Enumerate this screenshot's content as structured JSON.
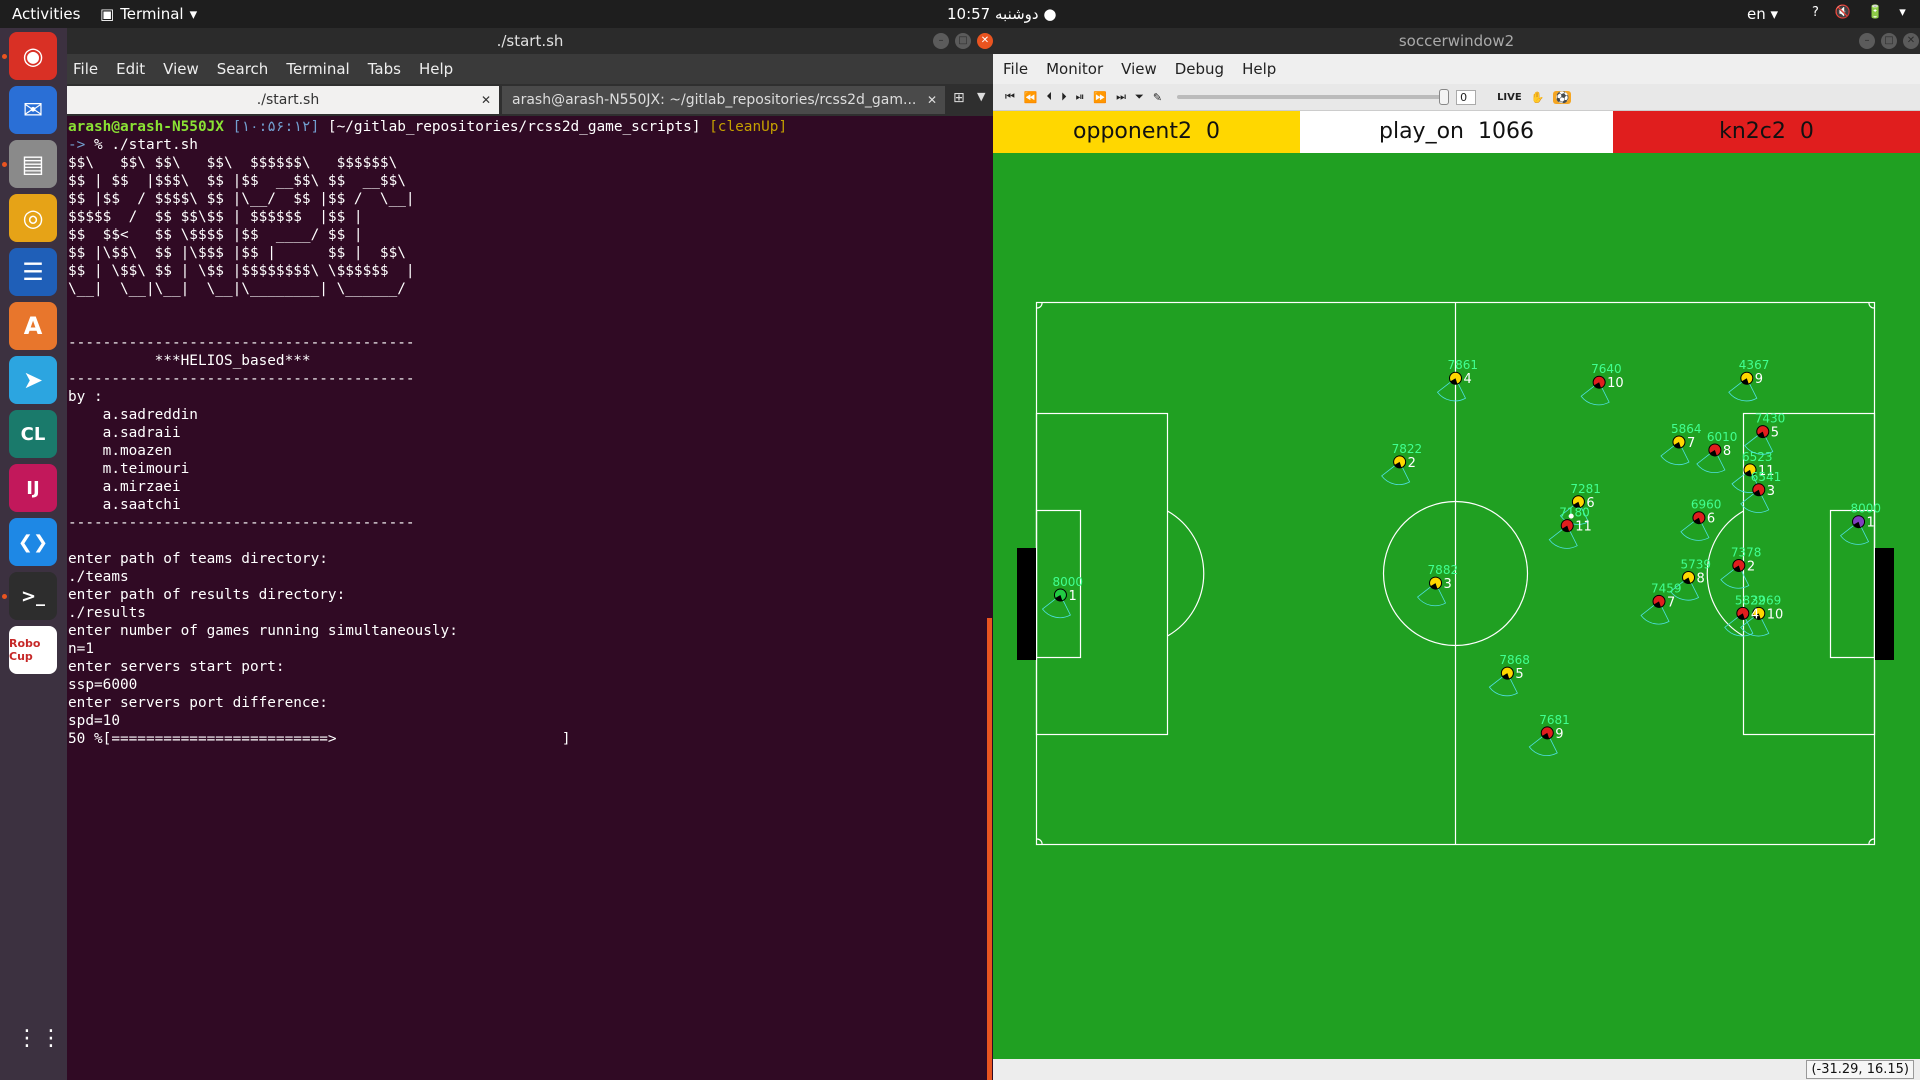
{
  "topbar": {
    "activities": "Activities",
    "app_name": "Terminal",
    "app_caret": "▾",
    "clock": "10:57 دوشنبه ●",
    "lang": "en ▾",
    "icons": [
      "?",
      "🔇",
      "🔋",
      "▾"
    ]
  },
  "dock": {
    "items": [
      {
        "name": "chrome-icon",
        "glyph": "◉",
        "bg": "#d93025"
      },
      {
        "name": "thunderbird-icon",
        "glyph": "✉",
        "bg": "#2a6fd6"
      },
      {
        "name": "files-icon",
        "glyph": "▤",
        "bg": "#8a8a8a"
      },
      {
        "name": "rhythmbox-icon",
        "glyph": "◎",
        "bg": "#e6a317"
      },
      {
        "name": "writer-icon",
        "glyph": "☰",
        "bg": "#1f5fb8"
      },
      {
        "name": "software-icon",
        "glyph": "A",
        "bg": "#e8762c"
      },
      {
        "name": "telegram-icon",
        "glyph": "➤",
        "bg": "#2ca5e0"
      },
      {
        "name": "clion-icon",
        "glyph": "CL",
        "bg": "#1a7a6b"
      },
      {
        "name": "intellij-icon",
        "glyph": "IJ",
        "bg": "#c2185b"
      },
      {
        "name": "vscode-icon",
        "glyph": "❮❯",
        "bg": "#1e88e5"
      },
      {
        "name": "terminal-icon",
        "glyph": ">_",
        "bg": "#2d2d2d"
      },
      {
        "name": "robocup-icon",
        "glyph": "Robo Cup",
        "bg": "#ffffff"
      }
    ],
    "apps_grid_glyph": "⋮⋮⋮"
  },
  "terminal": {
    "title": "./start.sh",
    "menu": [
      "File",
      "Edit",
      "View",
      "Search",
      "Terminal",
      "Tabs",
      "Help"
    ],
    "tabs": [
      {
        "label": "./start.sh",
        "active": true
      },
      {
        "label": "arash@arash-N550JX: ~/gitlab_repositories/rcss2d_gam...",
        "active": false
      }
    ],
    "prompt_user": "arash@arash-N550JX",
    "prompt_time": " [۱۰:۵۶:۱۲]",
    "prompt_path": " [~/gitlab_repositories/rcss2d_game_scripts]",
    "prompt_branch": " [cleanUp]",
    "prompt_cmd_prefix": "-> ",
    "prompt_cmd": "% ./start.sh",
    "output": "\n$$\\   $$\\ $$\\   $$\\  $$$$$$\\   $$$$$$\\\n$$ | $$  |$$$\\  $$ |$$  __$$\\ $$  __$$\\\n$$ |$$  / $$$$\\ $$ |\\__/  $$ |$$ /  \\__|\n$$$$$  /  $$ $$\\$$ | $$$$$$  |$$ |\n$$  $$<   $$ \\$$$$ |$$  ____/ $$ |\n$$ |\\$$\\  $$ |\\$$$ |$$ |      $$ |  $$\\\n$$ | \\$$\\ $$ | \\$$ |$$$$$$$$\\ \\$$$$$$  |\n\\__|  \\__|\\__|  \\__|\\________| \\______/\n\n\n----------------------------------------\n          ***HELIOS_based***\n----------------------------------------\nby :\n    a.sadreddin\n    a.sadraii\n    m.moazen\n    m.teimouri\n    a.mirzaei\n    a.saatchi\n----------------------------------------\n\nenter path of teams directory:\n./teams\nenter path of results directory:\n./results\nenter number of games running simultaneously:\nn=1\nenter servers start port:\nssp=6000\nenter servers port difference:\nspd=10\n50 %[=========================>                          ]"
  },
  "soccerwindow": {
    "title": "soccerwindow2",
    "menu": [
      "File",
      "Monitor",
      "View",
      "Debug",
      "Help"
    ],
    "toolbar": {
      "glyphs": [
        "⏮",
        "⏪",
        "⏴",
        "⏵",
        "⏯",
        "⏩",
        "⏭",
        "⏷",
        "✎"
      ],
      "slider_value": "0",
      "live_label": "LIVE",
      "hand_glyph": "✋",
      "logo_glyph": "⚽"
    },
    "score": {
      "left_team": "opponent2",
      "left_score": "0",
      "mode": "play_on",
      "cycle": "1066",
      "right_team": "kn2c2",
      "right_score": "0"
    },
    "coord": "(-31.29, 16.15)",
    "colors": {
      "field": "#20a022",
      "yellow_team": "#ffd700",
      "red_team": "#e01e1e",
      "mode_bg": "#ffffff"
    },
    "players": [
      {
        "team": "yellow",
        "unum": "4",
        "stamina": "7861",
        "x": 0.0,
        "y": -24.5
      },
      {
        "team": "yellow",
        "unum": "2",
        "stamina": "7822",
        "x": -7.0,
        "y": -14.0
      },
      {
        "team": "yellow",
        "unum": "3",
        "stamina": "7882",
        "x": -2.5,
        "y": 1.2
      },
      {
        "team": "yellow",
        "unum": "5",
        "stamina": "7868",
        "x": 6.5,
        "y": 12.5
      },
      {
        "team": "yellow",
        "unum": "6",
        "stamina": "7281",
        "x": 15.4,
        "y": -9.0
      },
      {
        "team": "yellow",
        "unum": "7",
        "stamina": "5864",
        "x": 28.0,
        "y": -16.5
      },
      {
        "team": "yellow",
        "unum": "8",
        "stamina": "5739",
        "x": 29.2,
        "y": 0.5
      },
      {
        "team": "yellow",
        "unum": "9",
        "stamina": "4367",
        "x": 36.5,
        "y": -24.5
      },
      {
        "team": "yellow",
        "unum": "10",
        "stamina": "3969",
        "x": 38.0,
        "y": 5.0
      },
      {
        "team": "yellow",
        "unum": "11",
        "stamina": "6523",
        "x": 36.9,
        "y": -13.0
      },
      {
        "team": "yellow",
        "unum": "1",
        "stamina": "8000",
        "x": -49.5,
        "y": 2.7,
        "goalie": true
      },
      {
        "team": "red",
        "unum": "10",
        "stamina": "7640",
        "x": 18.0,
        "y": -24.0
      },
      {
        "team": "red",
        "unum": "11",
        "stamina": "7180",
        "x": 14.0,
        "y": -6.0
      },
      {
        "team": "red",
        "unum": "9",
        "stamina": "7681",
        "x": 11.5,
        "y": 20.0
      },
      {
        "team": "red",
        "unum": "8",
        "stamina": "6010",
        "x": 32.5,
        "y": -15.5
      },
      {
        "team": "red",
        "unum": "6",
        "stamina": "6960",
        "x": 30.5,
        "y": -7.0
      },
      {
        "team": "red",
        "unum": "5",
        "stamina": "7430",
        "x": 38.5,
        "y": -17.8
      },
      {
        "team": "red",
        "unum": "3",
        "stamina": "6541",
        "x": 38.0,
        "y": -10.5
      },
      {
        "team": "red",
        "unum": "2",
        "stamina": "7378",
        "x": 35.5,
        "y": -1.0
      },
      {
        "team": "red",
        "unum": "7",
        "stamina": "7459",
        "x": 25.5,
        "y": 3.5
      },
      {
        "team": "red",
        "unum": "4",
        "stamina": "5822",
        "x": 36.0,
        "y": 5.0
      },
      {
        "team": "red",
        "unum": "1",
        "stamina": "8000",
        "x": 50.5,
        "y": -6.5,
        "goalie": true
      }
    ],
    "ball": {
      "x": 14.5,
      "y": -7.2
    }
  }
}
